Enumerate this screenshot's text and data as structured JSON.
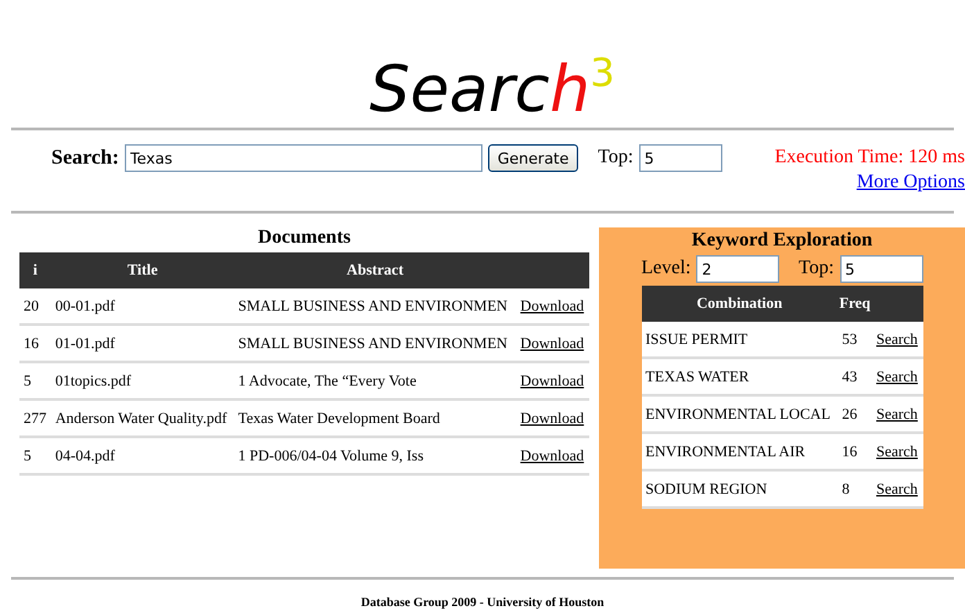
{
  "logo": {
    "parts": [
      {
        "text": "Searc",
        "color": "#000000",
        "raised": false
      },
      {
        "text": "h",
        "color": "#ee1111",
        "raised": false
      },
      {
        "text": "3",
        "color": "#dddd00",
        "raised": true
      }
    ]
  },
  "search": {
    "label": "Search:",
    "value": "Texas",
    "button": "Generate",
    "top_label": "Top:",
    "top_value": "5",
    "execution_time": "Execution Time: 120 ms",
    "more_options": "More Options"
  },
  "documents": {
    "title": "Documents",
    "columns": [
      "i",
      "Title",
      "Abstract"
    ],
    "rows": [
      {
        "i": "20",
        "title": "00-01.pdf",
        "abstract": "SMALL BUSINESS AND ENVIRONMEN",
        "action": "Download"
      },
      {
        "i": "16",
        "title": "01-01.pdf",
        "abstract": "SMALL BUSINESS AND ENVIRONMEN",
        "action": "Download"
      },
      {
        "i": "5",
        "title": "01topics.pdf",
        "abstract": "1 Advocate, The “Every Vote",
        "action": "Download"
      },
      {
        "i": "277",
        "title": "Anderson Water Quality.pdf",
        "abstract": "Texas Water Development Board",
        "action": "Download"
      },
      {
        "i": "5",
        "title": "04-04.pdf",
        "abstract": "1 PD-006/04-04 Volume 9, Iss",
        "action": "Download"
      }
    ]
  },
  "keywords": {
    "title": "Keyword Exploration",
    "level_label": "Level:",
    "level_value": "2",
    "top_label": "Top:",
    "top_value": "5",
    "columns": [
      "Combination",
      "Freq"
    ],
    "rows": [
      {
        "combination": "ISSUE PERMIT",
        "freq": "53",
        "action": "Search"
      },
      {
        "combination": "TEXAS WATER",
        "freq": "43",
        "action": "Search"
      },
      {
        "combination": "ENVIRONMENTAL LOCAL",
        "freq": "26",
        "action": "Search"
      },
      {
        "combination": "ENVIRONMENTAL AIR",
        "freq": "16",
        "action": "Search"
      },
      {
        "combination": "SODIUM REGION",
        "freq": "8",
        "action": "Search"
      }
    ]
  },
  "footer": "Database Group 2009 - University of Houston"
}
